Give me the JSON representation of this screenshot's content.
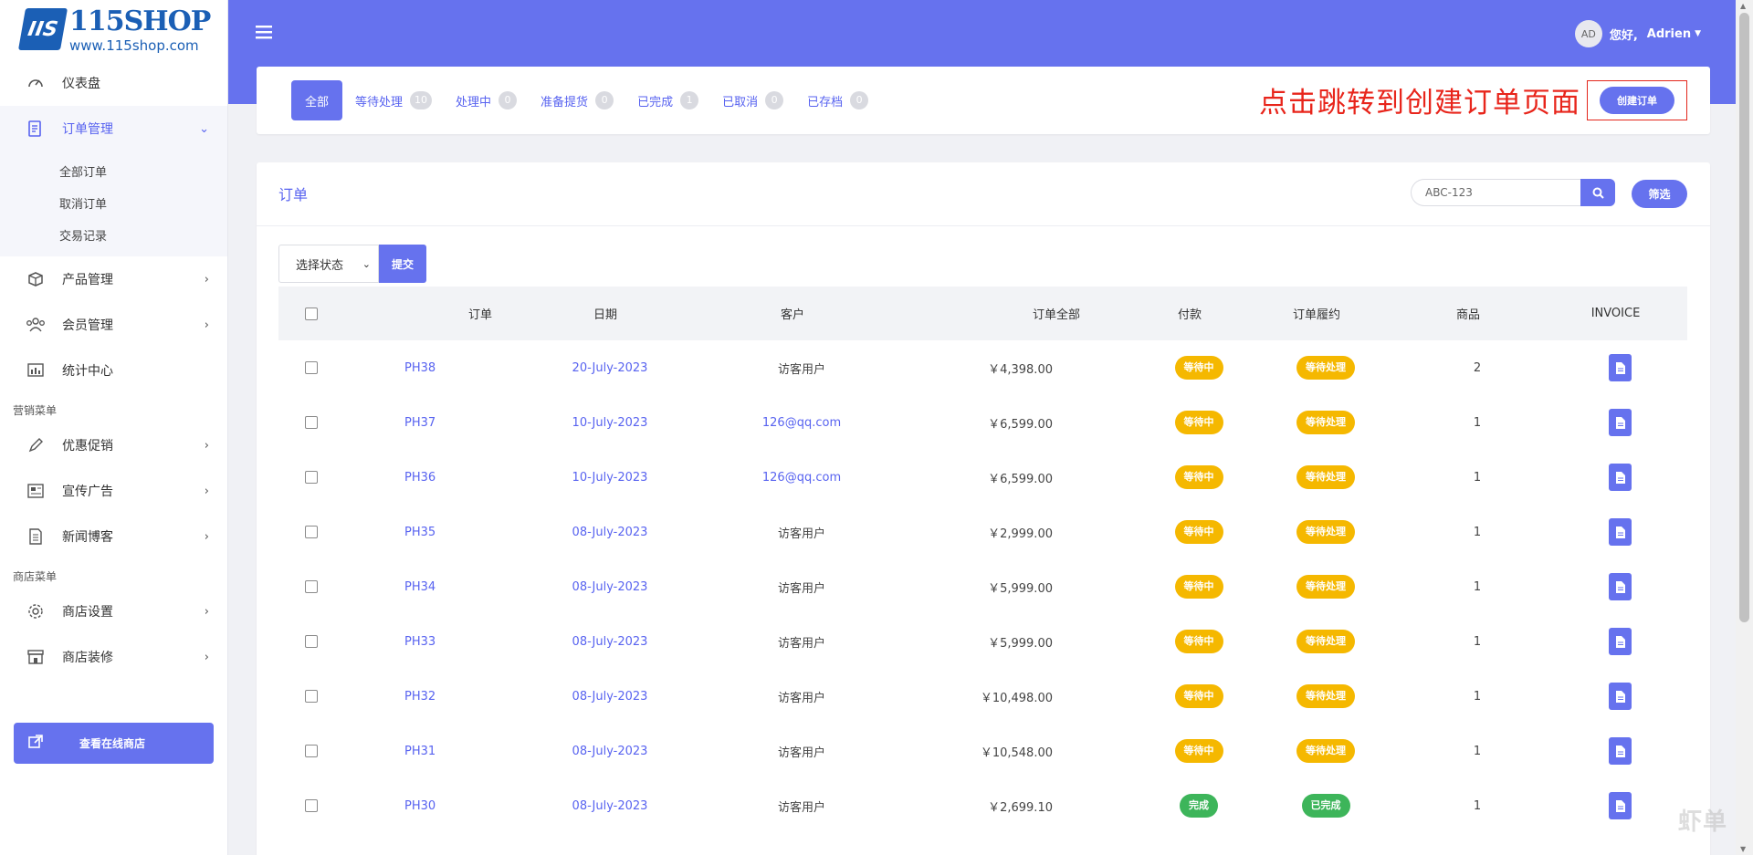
{
  "brand": {
    "mark": "IIS",
    "name": "115SHOP",
    "url": "www.115shop.com"
  },
  "sidebar": {
    "items": [
      {
        "label": "仪表盘",
        "icon": "dashboard-icon"
      },
      {
        "label": "订单管理",
        "icon": "orders-icon",
        "active": true,
        "sub": [
          "全部订单",
          "取消订单",
          "交易记录"
        ]
      },
      {
        "label": "产品管理",
        "icon": "box-icon"
      },
      {
        "label": "会员管理",
        "icon": "users-icon"
      },
      {
        "label": "统计中心",
        "icon": "chart-icon"
      }
    ],
    "section_marketing": "营销菜单",
    "marketing_items": [
      {
        "label": "优惠促销",
        "icon": "pen-icon"
      },
      {
        "label": "宣传广告",
        "icon": "newspaper-icon"
      },
      {
        "label": "新闻博客",
        "icon": "document-icon"
      }
    ],
    "section_store": "商店菜单",
    "store_items": [
      {
        "label": "商店设置",
        "icon": "gear-icon"
      },
      {
        "label": "商店装修",
        "icon": "storefront-icon"
      }
    ],
    "view_store": "查看在线商店"
  },
  "topbar": {
    "avatar": "AD",
    "greeting": "您好,",
    "username": "Adrien"
  },
  "tabs": [
    {
      "label": "全部",
      "count": null,
      "active": true
    },
    {
      "label": "等待处理",
      "count": "10"
    },
    {
      "label": "处理中",
      "count": "0"
    },
    {
      "label": "准备提货",
      "count": "0"
    },
    {
      "label": "已完成",
      "count": "1"
    },
    {
      "label": "已取消",
      "count": "0"
    },
    {
      "label": "已存档",
      "count": "0"
    }
  ],
  "annotation": "点击跳转到创建订单页面",
  "create_order": "创建订单",
  "orders": {
    "title": "订单",
    "search_placeholder": "ABC-123",
    "filter": "筛选",
    "status_select": "选择状态",
    "submit": "提交",
    "columns": [
      "订单",
      "日期",
      "客户",
      "订单全部",
      "付款",
      "订单履约",
      "商品",
      "INVOICE"
    ],
    "rows": [
      {
        "id": "PH38",
        "date": "20-July-2023",
        "customer": "访客用户",
        "customer_link": false,
        "total": "￥4,398.00",
        "payment": "等待中",
        "payment_status": "pending",
        "fulfillment": "等待处理",
        "fulfillment_status": "pending",
        "items": "2"
      },
      {
        "id": "PH37",
        "date": "10-July-2023",
        "customer": "126@qq.com",
        "customer_link": true,
        "total": "￥6,599.00",
        "payment": "等待中",
        "payment_status": "pending",
        "fulfillment": "等待处理",
        "fulfillment_status": "pending",
        "items": "1"
      },
      {
        "id": "PH36",
        "date": "10-July-2023",
        "customer": "126@qq.com",
        "customer_link": true,
        "total": "￥6,599.00",
        "payment": "等待中",
        "payment_status": "pending",
        "fulfillment": "等待处理",
        "fulfillment_status": "pending",
        "items": "1"
      },
      {
        "id": "PH35",
        "date": "08-July-2023",
        "customer": "访客用户",
        "customer_link": false,
        "total": "￥2,999.00",
        "payment": "等待中",
        "payment_status": "pending",
        "fulfillment": "等待处理",
        "fulfillment_status": "pending",
        "items": "1"
      },
      {
        "id": "PH34",
        "date": "08-July-2023",
        "customer": "访客用户",
        "customer_link": false,
        "total": "￥5,999.00",
        "payment": "等待中",
        "payment_status": "pending",
        "fulfillment": "等待处理",
        "fulfillment_status": "pending",
        "items": "1"
      },
      {
        "id": "PH33",
        "date": "08-July-2023",
        "customer": "访客用户",
        "customer_link": false,
        "total": "￥5,999.00",
        "payment": "等待中",
        "payment_status": "pending",
        "fulfillment": "等待处理",
        "fulfillment_status": "pending",
        "items": "1"
      },
      {
        "id": "PH32",
        "date": "08-July-2023",
        "customer": "访客用户",
        "customer_link": false,
        "total": "￥10,498.00",
        "payment": "等待中",
        "payment_status": "pending",
        "fulfillment": "等待处理",
        "fulfillment_status": "pending",
        "items": "1"
      },
      {
        "id": "PH31",
        "date": "08-July-2023",
        "customer": "访客用户",
        "customer_link": false,
        "total": "￥10,548.00",
        "payment": "等待中",
        "payment_status": "pending",
        "fulfillment": "等待处理",
        "fulfillment_status": "pending",
        "items": "1"
      },
      {
        "id": "PH30",
        "date": "08-July-2023",
        "customer": "访客用户",
        "customer_link": false,
        "total": "￥2,699.10",
        "payment": "完成",
        "payment_status": "done",
        "fulfillment": "已完成",
        "fulfillment_status": "done",
        "items": "1"
      }
    ]
  },
  "colors": {
    "accent": "#6672ee",
    "pending": "#f5b800",
    "done": "#3db55a",
    "annotation": "#e8251b"
  },
  "watermark": "虾单"
}
